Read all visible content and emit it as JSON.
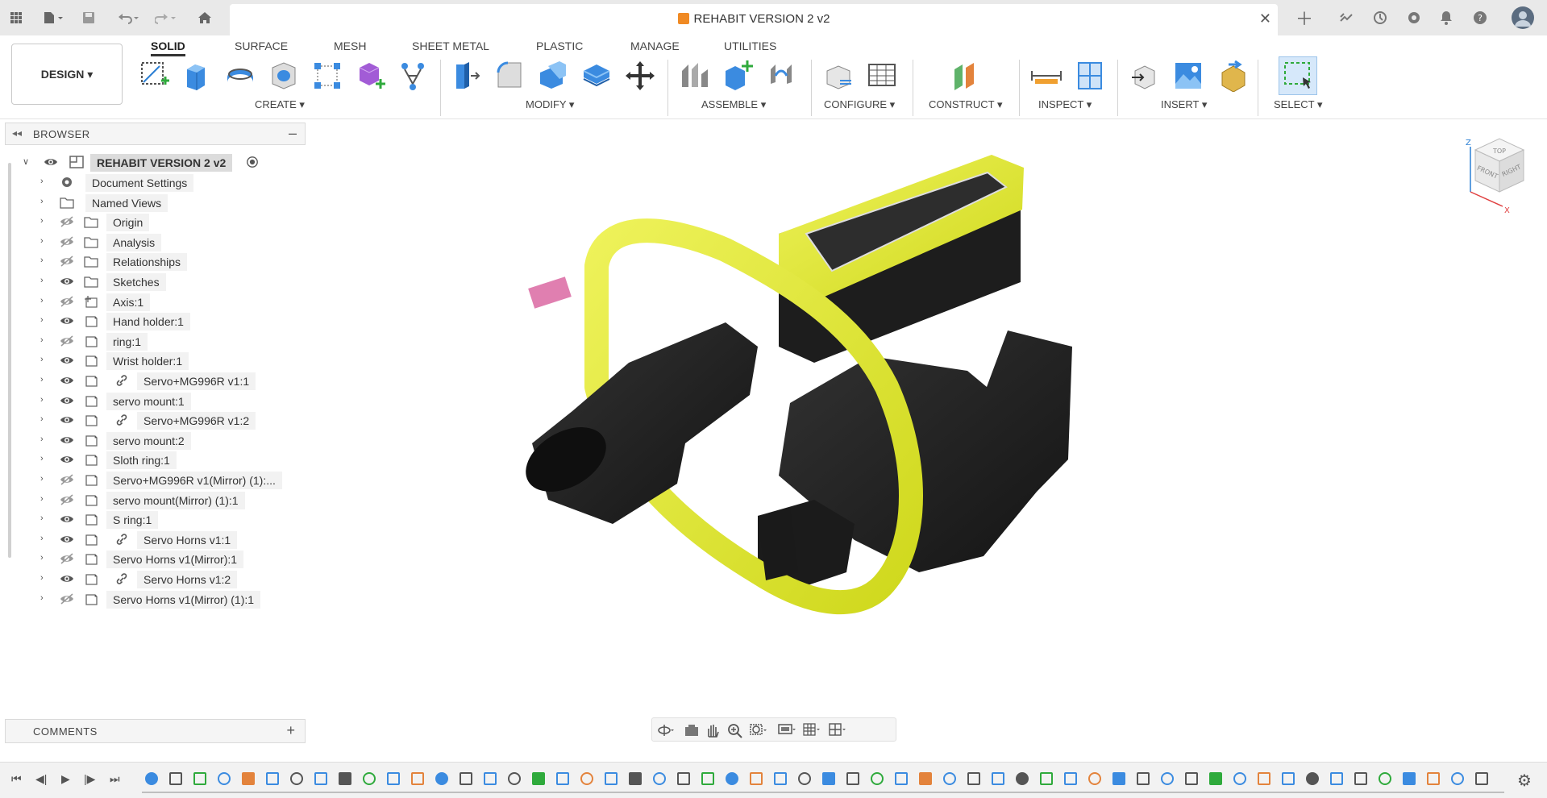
{
  "titlebar": {
    "document_title": "REHABIT VERSION 2 v2",
    "icons": [
      "apps-grid-icon",
      "file-icon",
      "save-icon",
      "undo-icon",
      "redo-icon",
      "home-icon",
      "close-icon",
      "new-tab-icon",
      "extensions-icon",
      "job-status-icon",
      "clock-icon",
      "notifications-icon",
      "help-icon",
      "user-avatar-icon"
    ]
  },
  "toolbar": {
    "design_label": "DESIGN ▾",
    "tabs": [
      {
        "label": "SOLID",
        "active": true
      },
      {
        "label": "SURFACE"
      },
      {
        "label": "MESH"
      },
      {
        "label": "SHEET METAL"
      },
      {
        "label": "PLASTIC"
      },
      {
        "label": "MANAGE"
      },
      {
        "label": "UTILITIES"
      }
    ],
    "groups": {
      "create": "CREATE ▾",
      "modify": "MODIFY ▾",
      "assemble": "ASSEMBLE ▾",
      "configure": "CONFIGURE ▾",
      "construct": "CONSTRUCT ▾",
      "inspect": "INSPECT ▾",
      "insert": "INSERT ▾",
      "select": "SELECT ▾"
    }
  },
  "browser": {
    "title": "BROWSER",
    "root": "REHABIT VERSION 2 v2",
    "items": [
      {
        "label": "Document Settings",
        "icon": "gear-icon",
        "eye": "none"
      },
      {
        "label": "Named Views",
        "icon": "folder-icon",
        "eye": "none"
      },
      {
        "label": "Origin",
        "icon": "folder-icon",
        "eye": "hidden"
      },
      {
        "label": "Analysis",
        "icon": "folder-icon",
        "eye": "hidden"
      },
      {
        "label": "Relationships",
        "icon": "folder-icon",
        "eye": "hidden"
      },
      {
        "label": "Sketches",
        "icon": "folder-icon",
        "eye": "visible"
      },
      {
        "label": "Axis:1",
        "icon": "axis-icon",
        "eye": "hidden"
      },
      {
        "label": "Hand holder:1",
        "icon": "component-icon",
        "eye": "visible"
      },
      {
        "label": "ring:1",
        "icon": "component-icon",
        "eye": "hidden"
      },
      {
        "label": "Wrist holder:1",
        "icon": "component-icon",
        "eye": "visible"
      },
      {
        "label": "Servo+MG996R v1:1",
        "icon": "component-icon",
        "eye": "visible",
        "linked": true
      },
      {
        "label": "servo mount:1",
        "icon": "component-icon",
        "eye": "visible"
      },
      {
        "label": "Servo+MG996R v1:2",
        "icon": "component-icon",
        "eye": "visible",
        "linked": true
      },
      {
        "label": "servo mount:2",
        "icon": "component-icon",
        "eye": "visible"
      },
      {
        "label": "Sloth ring:1",
        "icon": "component-icon",
        "eye": "visible"
      },
      {
        "label": "Servo+MG996R v1(Mirror) (1):...",
        "icon": "component-icon",
        "eye": "hidden"
      },
      {
        "label": "servo mount(Mirror) (1):1",
        "icon": "component-icon",
        "eye": "hidden"
      },
      {
        "label": "S ring:1",
        "icon": "component-icon",
        "eye": "visible"
      },
      {
        "label": "Servo Horns v1:1",
        "icon": "component-icon",
        "eye": "visible",
        "linked": true
      },
      {
        "label": "Servo Horns v1(Mirror):1",
        "icon": "component-icon",
        "eye": "hidden"
      },
      {
        "label": "Servo Horns v1:2",
        "icon": "component-icon",
        "eye": "visible",
        "linked": true
      },
      {
        "label": "Servo Horns v1(Mirror) (1):1",
        "icon": "component-icon",
        "eye": "hidden"
      }
    ]
  },
  "comments": {
    "title": "COMMENTS"
  },
  "viewcube": {
    "top": "TOP",
    "front": "FRONT",
    "right": "RIGHT",
    "axis_x": "X",
    "axis_z": "Z"
  },
  "colors": {
    "accent": "#e6ee3a",
    "model_dark": "#1c1c1c",
    "icon_blue": "#2b7fd4"
  }
}
